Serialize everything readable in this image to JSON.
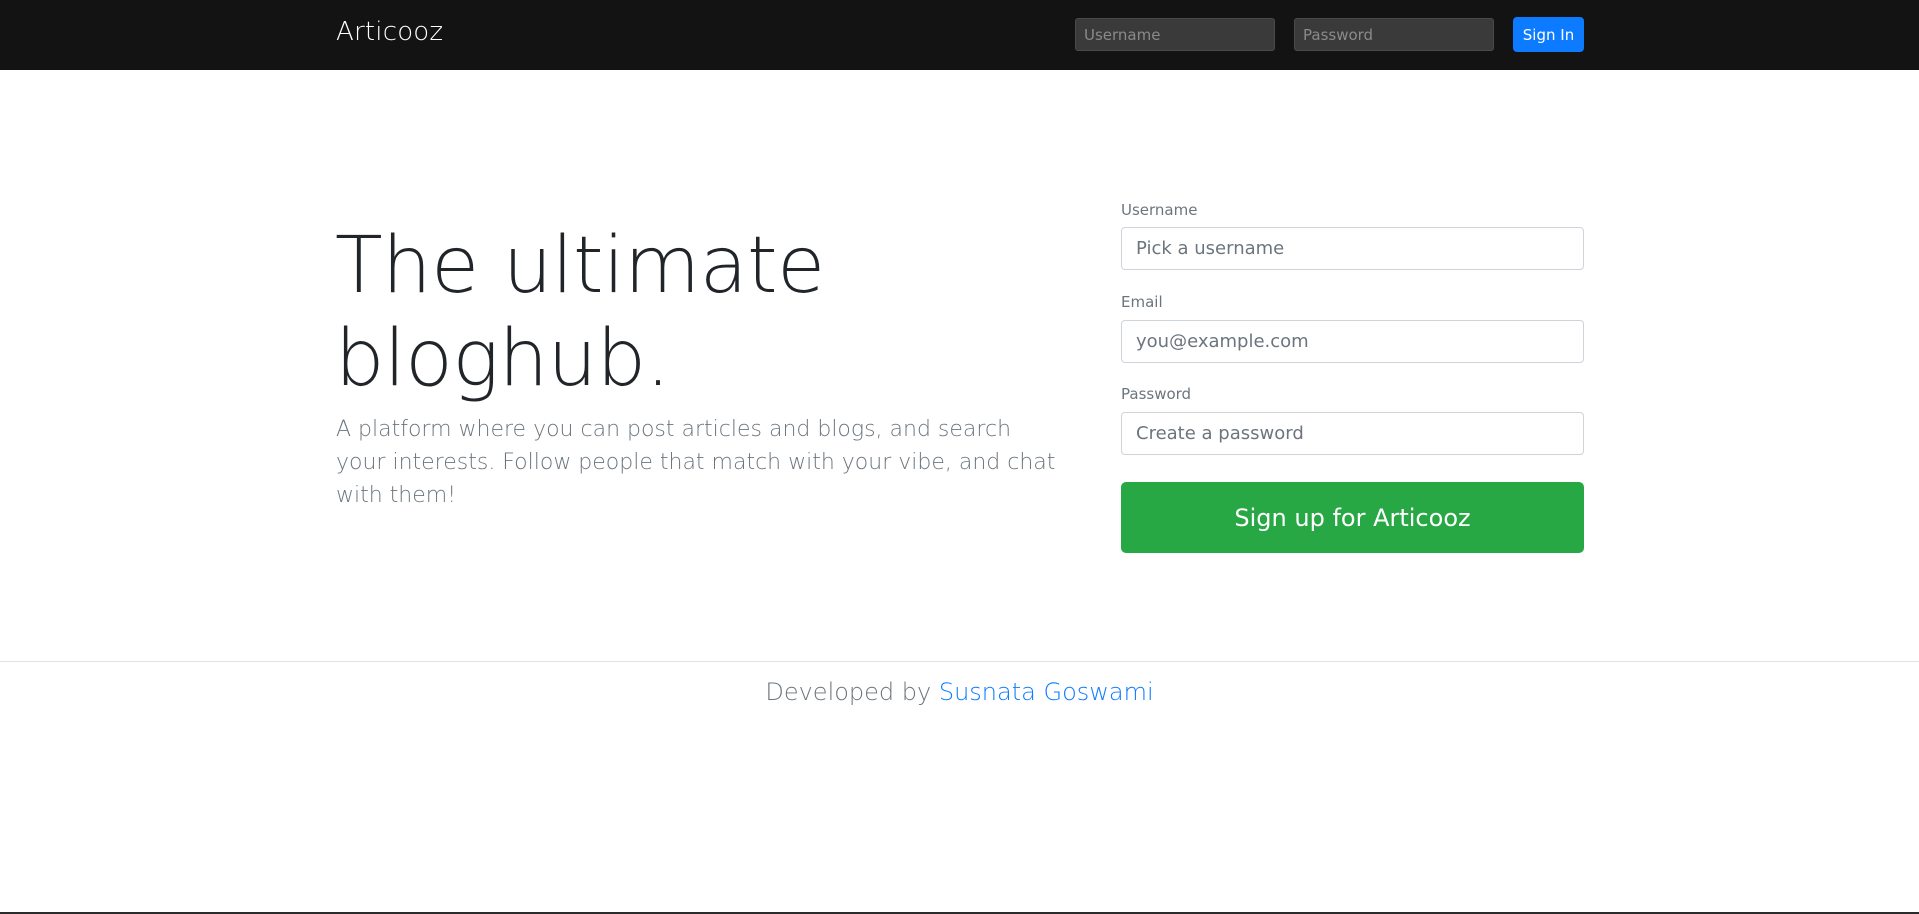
{
  "navbar": {
    "brand": "Articooz",
    "username_placeholder": "Username",
    "password_placeholder": "Password",
    "signin_label": "Sign In",
    "colors": {
      "background": "#131313",
      "signin": "#0d7bff"
    }
  },
  "hero": {
    "title_line1": "The ultimate",
    "title_line2": "bloghub.",
    "lead": "A platform where you can post articles and blogs, and search your interests. Follow people that match with your vibe, and chat with them!"
  },
  "signup_form": {
    "username_label": "Username",
    "username_placeholder": "Pick a username",
    "email_label": "Email",
    "email_placeholder": "you@example.com",
    "password_label": "Password",
    "password_placeholder": "Create a password",
    "submit_label": "Sign up for Articooz",
    "colors": {
      "submit": "#28a745"
    }
  },
  "footer": {
    "prefix": "Developed by ",
    "author": "Susnata Goswami",
    "colors": {
      "link": "#0d7bff"
    }
  }
}
